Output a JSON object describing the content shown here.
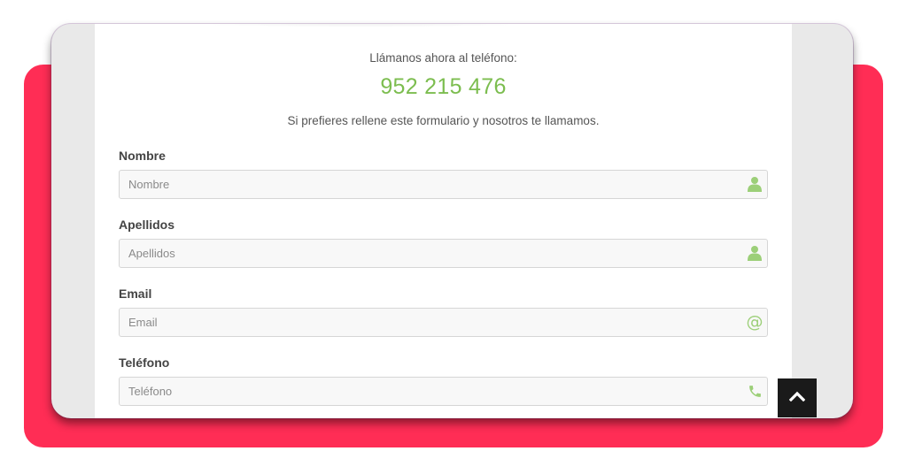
{
  "contact": {
    "call_text": "Llámanos ahora al teléfono:",
    "phone": "952 215 476",
    "intro": "Si prefieres rellene este formulario y nosotros te llamamos."
  },
  "form": {
    "nombre": {
      "label": "Nombre",
      "placeholder": "Nombre",
      "value": ""
    },
    "apellidos": {
      "label": "Apellidos",
      "placeholder": "Apellidos",
      "value": ""
    },
    "email": {
      "label": "Email",
      "placeholder": "Email",
      "value": ""
    },
    "telefono": {
      "label": "Teléfono",
      "placeholder": "Teléfono",
      "value": ""
    }
  },
  "icons": {
    "nombre": "user-icon",
    "apellidos": "user-icon",
    "email": "at-sign-icon",
    "telefono": "phone-icon",
    "scroll_top": "chevron-up-icon"
  },
  "colors": {
    "accent": "#7cbd4f",
    "icon": "#9ccf78",
    "backdrop": "#ff2d55",
    "scroll_button": "#1a1a1a"
  }
}
